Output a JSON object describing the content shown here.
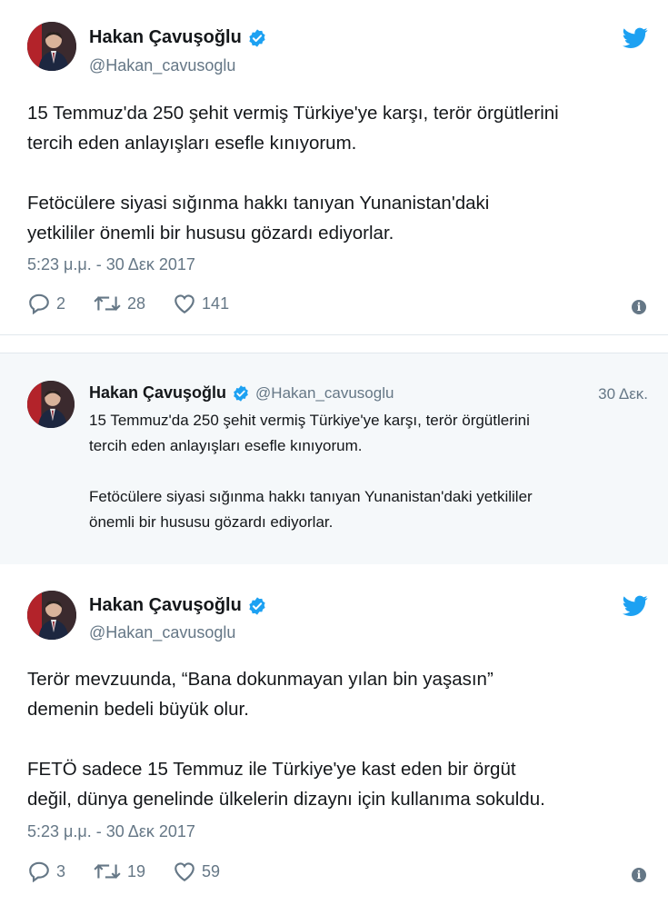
{
  "tweet1": {
    "name": "Hakan Çavuşoğlu",
    "handle": "@Hakan_cavusoglu",
    "paragraphs": [
      [
        "15 Temmuz'da 250 şehit vermiş Türkiye'ye karşı, terör örgütlerini",
        "tercih eden anlayışları esefle kınıyorum."
      ],
      [
        "Fetöcülere siyasi sığınma hakkı tanıyan Yunanistan'daki",
        "yetkililer önemli bir hususu gözardı ediyorlar."
      ]
    ],
    "time": "5:23 μ.μ. - 30 Δεκ 2017",
    "replies": "2",
    "retweets": "28",
    "likes": "141"
  },
  "reply_card": {
    "name": "Hakan Çavuşoğlu",
    "handle": "@Hakan_cavusoglu",
    "date": "30 Δεκ.",
    "paragraphs": [
      [
        "15 Temmuz'da 250 şehit vermiş Türkiye'ye karşı, terör örgütlerini",
        "tercih eden anlayışları esefle kınıyorum."
      ],
      [
        "Fetöcülere siyasi sığınma hakkı tanıyan Yunanistan'daki yetkililer",
        "önemli bir hususu gözardı ediyorlar."
      ]
    ]
  },
  "tweet2": {
    "name": "Hakan Çavuşoğlu",
    "handle": "@Hakan_cavusoglu",
    "paragraphs": [
      [
        "Terör mevzuunda, “Bana dokunmayan yılan bin yaşasın”",
        "demenin bedeli büyük olur."
      ],
      [
        "FETÖ sadece 15 Temmuz ile Türkiye'ye kast eden bir örgüt",
        "değil, dünya genelinde ülkelerin dizaynı için kullanıma sokuldu."
      ]
    ],
    "time": "5:23 μ.μ. - 30 Δεκ 2017",
    "replies": "3",
    "retweets": "19",
    "likes": "59"
  },
  "colors": {
    "twitter_blue": "#1da1f2",
    "muted": "#657786",
    "text": "#14171a",
    "card_bg": "#f5f8fa"
  },
  "icons": [
    "twitter-bird-icon",
    "verified-badge-icon",
    "reply-icon",
    "retweet-icon",
    "heart-icon",
    "info-icon"
  ]
}
